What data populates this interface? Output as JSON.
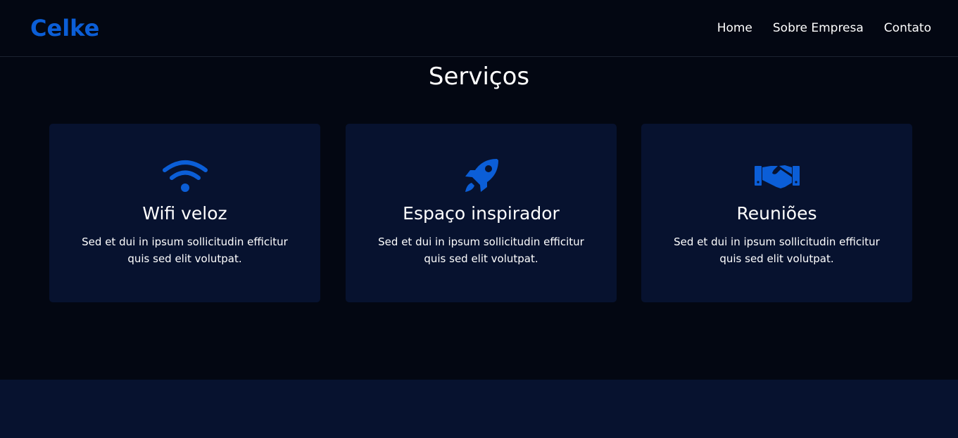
{
  "brand": {
    "name": "Celke",
    "color": "#0b5ed7"
  },
  "nav": {
    "items": [
      {
        "label": "Home"
      },
      {
        "label": "Sobre Empresa"
      },
      {
        "label": "Contato"
      }
    ]
  },
  "services": {
    "title": "Serviços",
    "cards": [
      {
        "icon": "wifi-icon",
        "title": "Wifi veloz",
        "text": "Sed et dui in ipsum sollicitudin efficitur quis sed elit volutpat."
      },
      {
        "icon": "rocket-icon",
        "title": "Espaço inspirador",
        "text": "Sed et dui in ipsum sollicitudin efficitur quis sed elit volutpat."
      },
      {
        "icon": "handshake-icon",
        "title": "Reuniões",
        "text": "Sed et dui in ipsum sollicitudin efficitur quis sed elit volutpat."
      }
    ]
  },
  "colors": {
    "background": "#030712",
    "card": "#07122f",
    "accent": "#0b5ed7",
    "text": "#ffffff"
  }
}
